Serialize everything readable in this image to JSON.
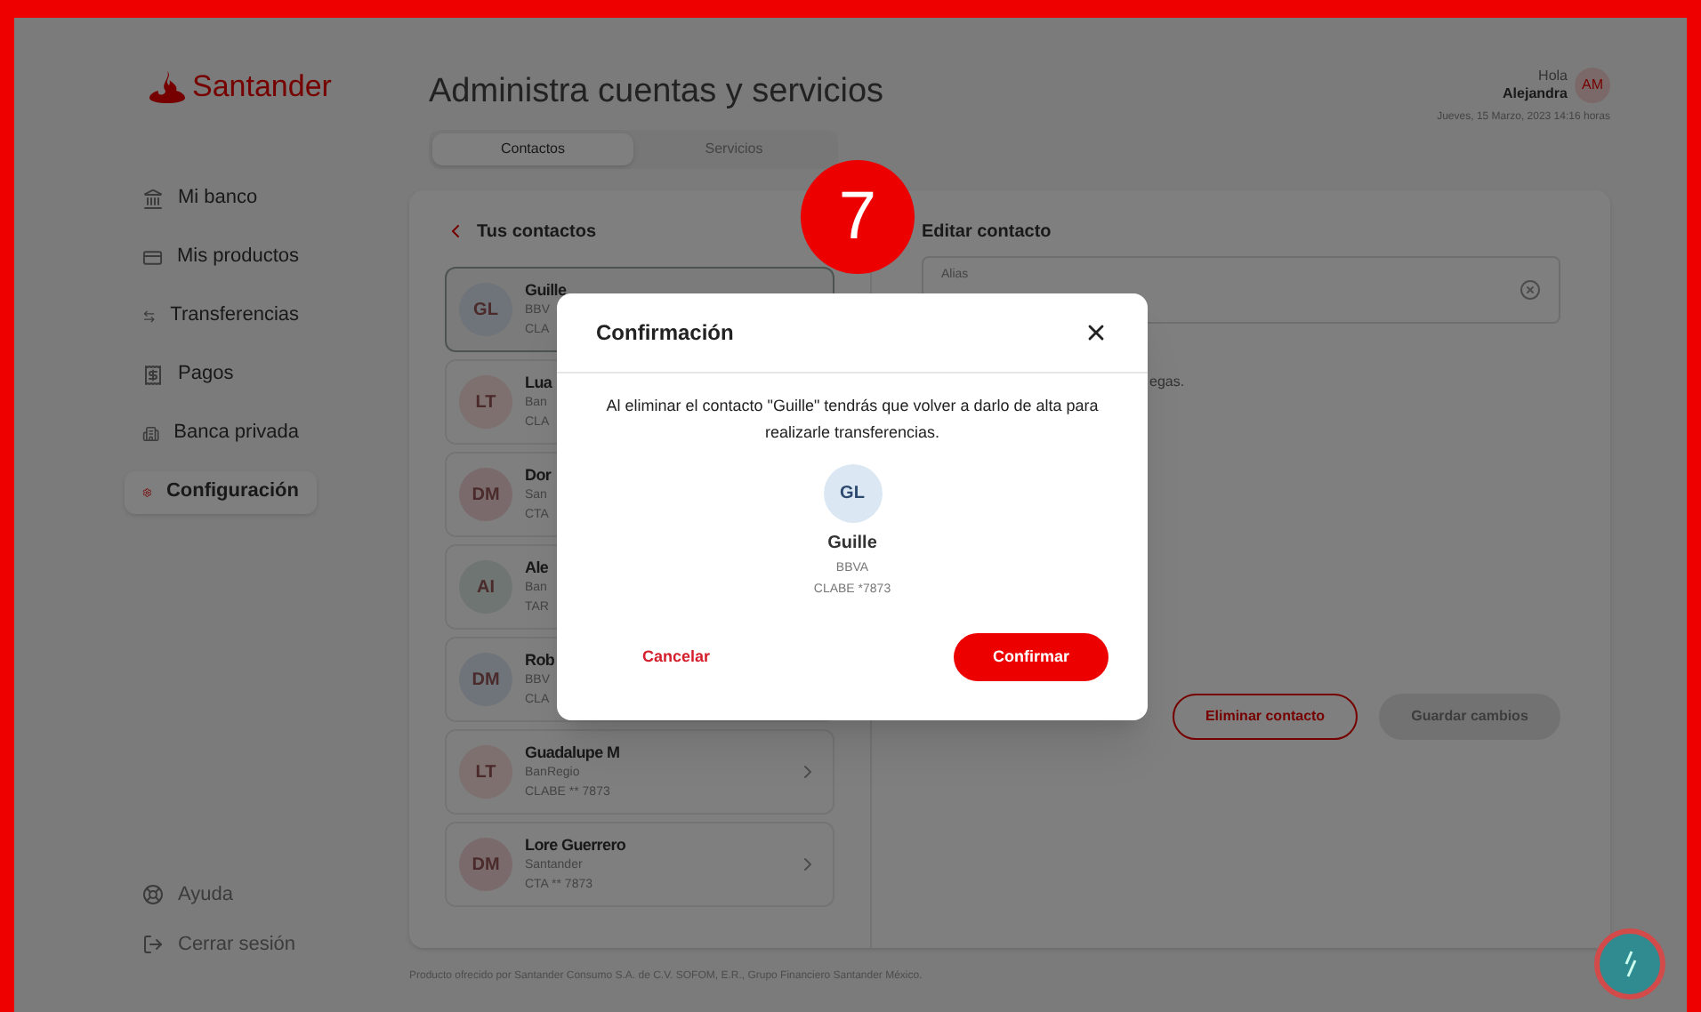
{
  "brand": {
    "name": "Santander"
  },
  "sidebar": {
    "items": [
      {
        "label": "Mi banco",
        "selected": false
      },
      {
        "label": "Mis productos",
        "selected": false
      },
      {
        "label": "Transferencias",
        "selected": false
      },
      {
        "label": "Pagos",
        "selected": false
      },
      {
        "label": "Banca privada",
        "selected": false
      },
      {
        "label": "Configuración",
        "selected": true
      }
    ],
    "footer_items": [
      {
        "label": "Ayuda"
      },
      {
        "label": "Cerrar sesión"
      }
    ]
  },
  "header": {
    "title": "Administra cuentas y servicios",
    "greeting": "Hola",
    "user_name": "Alejandra",
    "user_initials": "AM",
    "date": "Jueves, 15 Marzo, 2023 14:16 horas"
  },
  "tabs": [
    {
      "label": "Contactos",
      "selected": true
    },
    {
      "label": "Servicios",
      "selected": false
    }
  ],
  "contacts_panel": {
    "title": "Tus contactos",
    "contacts": [
      {
        "initials": "GL",
        "name": "Guille",
        "bank": "BBV",
        "account": "CLA",
        "color": "#6e7479",
        "selected": true
      },
      {
        "initials": "LT",
        "name": "Lua",
        "bank": "Ban",
        "account": "CLA",
        "color": "#7d706e",
        "selected": false
      },
      {
        "initials": "DM",
        "name": "Dor",
        "bank": "San",
        "account": "CTA",
        "color": "#7b6a6b",
        "selected": false
      },
      {
        "initials": "AI",
        "name": "Ale",
        "bank": "Ban",
        "account": "TAR",
        "color": "#6f7572",
        "selected": false
      },
      {
        "initials": "DM",
        "name": "Rob",
        "bank": "BBV",
        "account": "CLA",
        "color": "#6e7479",
        "selected": false
      },
      {
        "initials": "LT",
        "name": "Guadalupe M",
        "bank": "BanRegio",
        "account": "CLABE ** 7873",
        "color": "#7d706e",
        "selected": false
      },
      {
        "initials": "DM",
        "name": "Lore Guerrero",
        "bank": "Santander",
        "account": "CTA ** 7873",
        "color": "#7b6a6b",
        "selected": false
      }
    ]
  },
  "edit_panel": {
    "title": "Editar contacto",
    "alias_label": "Alias",
    "note": "egas.",
    "delete_button": "Eliminar contacto",
    "save_button": {
      "label": "Guardar cambios",
      "disabled": true
    }
  },
  "footer": "Producto ofrecido por Santander Consumo S.A. de C.V. SOFOM, E.R., Grupo Financiero Santander México.",
  "step_badge": "7",
  "dialog": {
    "title": "Confirmación",
    "message": "Al eliminar el contacto \"Guille\" tendrás que volver a darlo de alta para realizarle transferencias.",
    "contact": {
      "initials": "GL",
      "name": "Guille",
      "bank": "BBVA",
      "account": "CLABE *7873",
      "color": "#dbe7f2"
    },
    "cancel": "Cancelar",
    "confirm": "Confirmar"
  }
}
